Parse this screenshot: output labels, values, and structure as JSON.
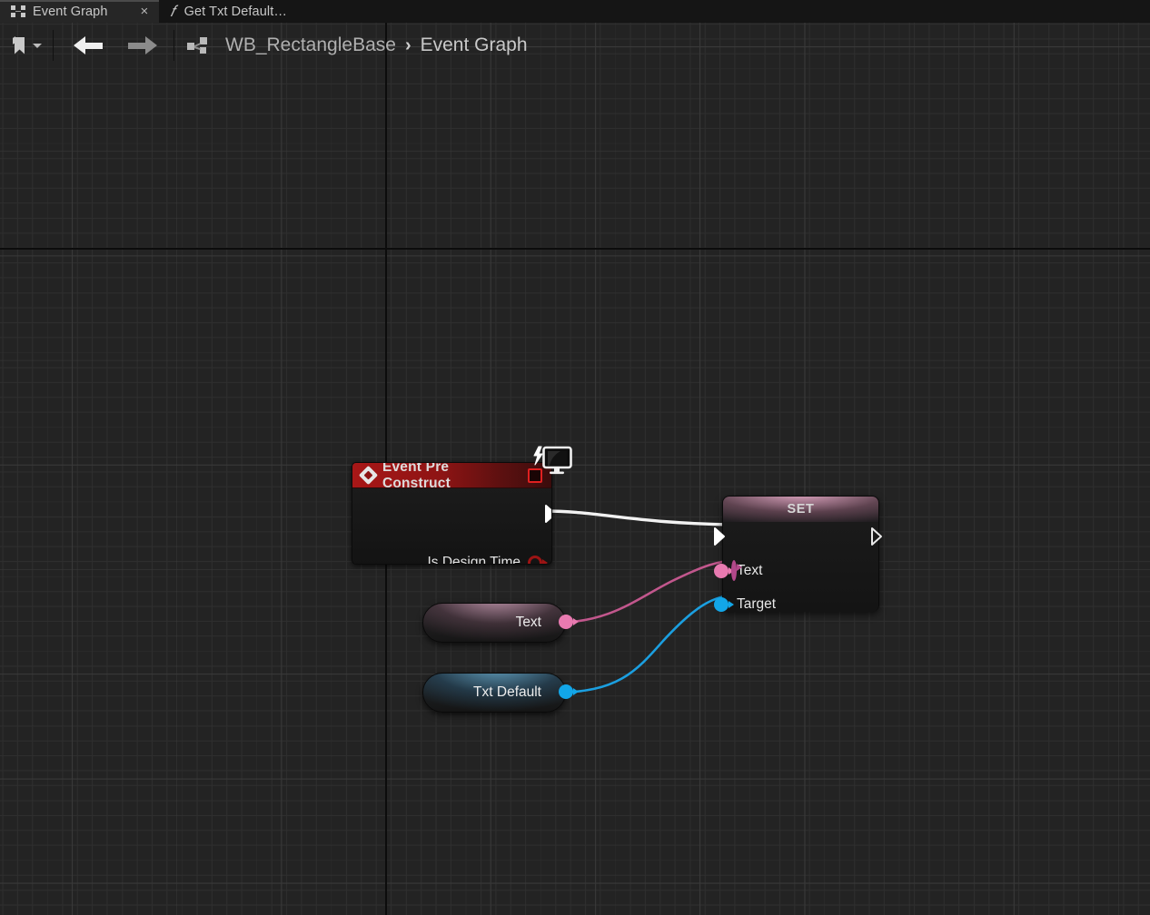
{
  "window": {
    "app": "Unreal Engine Blueprint Editor",
    "accent_red": "#a81717",
    "pin_exec": "#ffffff",
    "pin_text": "#e87ab0",
    "pin_object": "#12a6e8",
    "pin_bool": "#9c1414"
  },
  "tabs": [
    {
      "label": "Event Graph",
      "icon": "event-graph-icon",
      "close": "×",
      "active": true
    },
    {
      "label": "Get Txt Default…",
      "icon": "function-fx-icon",
      "active": false
    }
  ],
  "toolbar": {
    "bookmark_label": "Bookmarks",
    "bookmark_icon": "bookmark-icon",
    "dropdown_icon": "chevron-down-icon",
    "back_icon": "back-arrow-icon",
    "forward_icon": "forward-arrow-icon",
    "breadcrumb_icon": "event-graph-icon",
    "breadcrumb": {
      "root": "WB_RectangleBase",
      "separator": "›",
      "leaf": "Event Graph"
    }
  },
  "graph": {
    "nodes": [
      {
        "id": "event-pre-construct",
        "type": "event",
        "title": "Event Pre Construct",
        "title_icon": "event-diamond-icon",
        "delegate_icon": "delegate-pin-icon",
        "badge_icon": "monitor-icon",
        "outputs": [
          {
            "label": "",
            "kind": "exec"
          },
          {
            "label": "Is Design Time",
            "kind": "bool"
          }
        ]
      },
      {
        "id": "set-text",
        "type": "set",
        "title": "SET",
        "inputs": [
          {
            "label": "",
            "kind": "exec"
          },
          {
            "label": "Text",
            "kind": "text"
          },
          {
            "label": "Target",
            "kind": "object"
          }
        ],
        "outputs": [
          {
            "label": "",
            "kind": "exec"
          },
          {
            "label": "",
            "kind": "text"
          }
        ]
      },
      {
        "id": "get-text",
        "type": "variable-get",
        "title": "Text",
        "pin_kind": "text"
      },
      {
        "id": "get-txt-default",
        "type": "variable-get",
        "title": "Txt Default",
        "pin_kind": "object"
      }
    ],
    "wires": [
      {
        "from": "event-pre-construct.exec",
        "to": "set-text.exec",
        "color": "#ffffff"
      },
      {
        "from": "get-text.out",
        "to": "set-text.Text",
        "color": "#c2578d"
      },
      {
        "from": "get-txt-default.out",
        "to": "set-text.Target",
        "color": "#1b9fe0"
      }
    ]
  }
}
